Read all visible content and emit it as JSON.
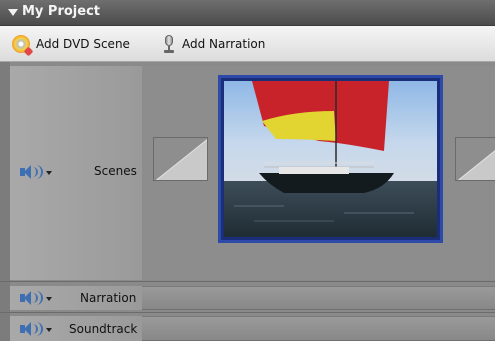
{
  "panel": {
    "title": "My Project"
  },
  "toolbar": {
    "add_dvd_scene": "Add DVD Scene",
    "add_narration": "Add Narration"
  },
  "tracks": {
    "scenes": "Scenes",
    "narration": "Narration",
    "soundtrack": "Soundtrack"
  },
  "colors": {
    "selection_border": "#2d4aa8",
    "speaker_icon": "#3f6fb3"
  },
  "icons": {
    "collapse": "triangle-down-icon",
    "dvd": "dvd-scene-icon",
    "narration": "microphone-icon",
    "volume": "speaker-icon"
  }
}
